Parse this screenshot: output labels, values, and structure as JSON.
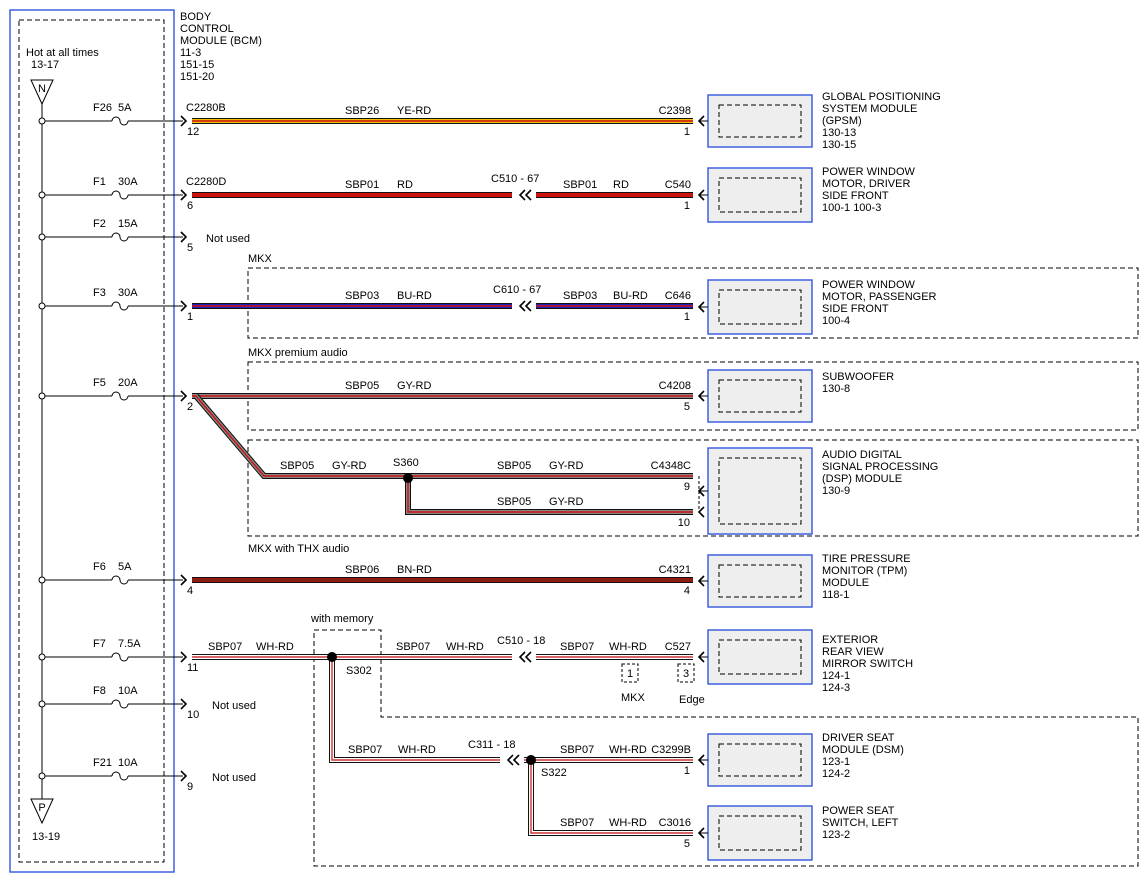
{
  "bcm": {
    "title": [
      "BODY",
      "CONTROL",
      "MODULE (BCM)",
      "11-3",
      "151-15",
      "151-20"
    ],
    "hot_label": "Hot at all times",
    "hot_ref": "13-17",
    "top_connector": "N",
    "bottom_connector": "P",
    "bottom_ref": "13-19"
  },
  "fuses": [
    {
      "id": "F26",
      "rating": "5A"
    },
    {
      "id": "F1",
      "rating": "30A"
    },
    {
      "id": "F2",
      "rating": "15A"
    },
    {
      "id": "F3",
      "rating": "30A"
    },
    {
      "id": "F5",
      "rating": "20A"
    },
    {
      "id": "F6",
      "rating": "5A"
    },
    {
      "id": "F7",
      "rating": "7.5A"
    },
    {
      "id": "F8",
      "rating": "10A"
    },
    {
      "id": "F21",
      "rating": "10A"
    }
  ],
  "bcm_pins": [
    {
      "connector": "C2280B",
      "pin": "12"
    },
    {
      "connector": "C2280D",
      "pin": "6"
    },
    {
      "connector": "",
      "pin": "5"
    },
    {
      "connector": "",
      "pin": "1"
    },
    {
      "connector": "",
      "pin": "2"
    },
    {
      "connector": "",
      "pin": "4"
    },
    {
      "connector": "",
      "pin": "11"
    },
    {
      "connector": "",
      "pin": "10"
    },
    {
      "connector": "",
      "pin": "9"
    }
  ],
  "not_used": "Not used",
  "groups": {
    "mkx": "MKX",
    "mkx_premium": "MKX premium audio",
    "mkx_thx": "MKX with THX audio",
    "with_memory": "with memory"
  },
  "wires": [
    {
      "circuit": "SBP26",
      "color": "YE-RD"
    },
    {
      "circuit": "SBP01",
      "color": "RD"
    },
    {
      "circuit": "SBP01",
      "color": "RD"
    },
    {
      "circuit": "SBP03",
      "color": "BU-RD"
    },
    {
      "circuit": "SBP03",
      "color": "BU-RD"
    },
    {
      "circuit": "SBP05",
      "color": "GY-RD"
    },
    {
      "circuit": "SBP05",
      "color": "GY-RD"
    },
    {
      "circuit": "SBP05",
      "color": "GY-RD"
    },
    {
      "circuit": "SBP05",
      "color": "GY-RD"
    },
    {
      "circuit": "SBP06",
      "color": "BN-RD"
    },
    {
      "circuit": "SBP07",
      "color": "WH-RD"
    },
    {
      "circuit": "SBP07",
      "color": "WH-RD"
    },
    {
      "circuit": "SBP07",
      "color": "WH-RD"
    },
    {
      "circuit": "SBP07",
      "color": "WH-RD"
    },
    {
      "circuit": "SBP07",
      "color": "WH-RD"
    },
    {
      "circuit": "SBP07",
      "color": "WH-RD"
    }
  ],
  "inline_connectors": [
    "C510 - 67",
    "C610 - 67",
    "C510 - 18",
    "C311 - 18"
  ],
  "splices": [
    "S360",
    "S302",
    "S322"
  ],
  "mirror_options": [
    {
      "pin": "1",
      "label": "MKX"
    },
    {
      "pin": "3",
      "label": "Edge"
    }
  ],
  "device_connectors": [
    {
      "connector": "C2398",
      "pin": "1"
    },
    {
      "connector": "C540",
      "pin": "1"
    },
    {
      "connector": "C646",
      "pin": "1"
    },
    {
      "connector": "C4208",
      "pin": "5"
    },
    {
      "connector": "C4348C",
      "pin": "9"
    },
    {
      "connector": "",
      "pin": "10"
    },
    {
      "connector": "C4321",
      "pin": "4"
    },
    {
      "connector": "C527",
      "pin": ""
    },
    {
      "connector": "C3299B",
      "pin": "1"
    },
    {
      "connector": "C3016",
      "pin": "5"
    }
  ],
  "modules": [
    {
      "lines": [
        "GLOBAL POSITIONING",
        "SYSTEM MODULE",
        "(GPSM)",
        "130-13",
        "130-15"
      ]
    },
    {
      "lines": [
        "POWER WINDOW",
        "MOTOR, DRIVER",
        "SIDE FRONT",
        "100-1    100-3"
      ]
    },
    {
      "lines": [
        "POWER WINDOW",
        "MOTOR, PASSENGER",
        "SIDE FRONT",
        "100-4"
      ]
    },
    {
      "lines": [
        "SUBWOOFER",
        "130-8"
      ]
    },
    {
      "lines": [
        "AUDIO DIGITAL",
        "SIGNAL PROCESSING",
        "(DSP) MODULE",
        "130-9"
      ]
    },
    {
      "lines": [
        "TIRE PRESSURE",
        "MONITOR (TPM)",
        "MODULE",
        "118-1"
      ]
    },
    {
      "lines": [
        "EXTERIOR",
        "REAR VIEW",
        "MIRROR SWITCH",
        "124-1",
        "124-3"
      ]
    },
    {
      "lines": [
        "DRIVER SEAT",
        "MODULE (DSM)",
        "123-1",
        "124-2"
      ]
    },
    {
      "lines": [
        "POWER SEAT",
        "SWITCH, LEFT",
        "123-2"
      ]
    }
  ],
  "colors": {
    "frame_blue": "#3355dd",
    "wire_red": "#cc1111",
    "wire_yellow": "#f2c200",
    "wire_blue": "#2222bb",
    "wire_gray": "#888888",
    "module_fill": "#eeeeee"
  }
}
